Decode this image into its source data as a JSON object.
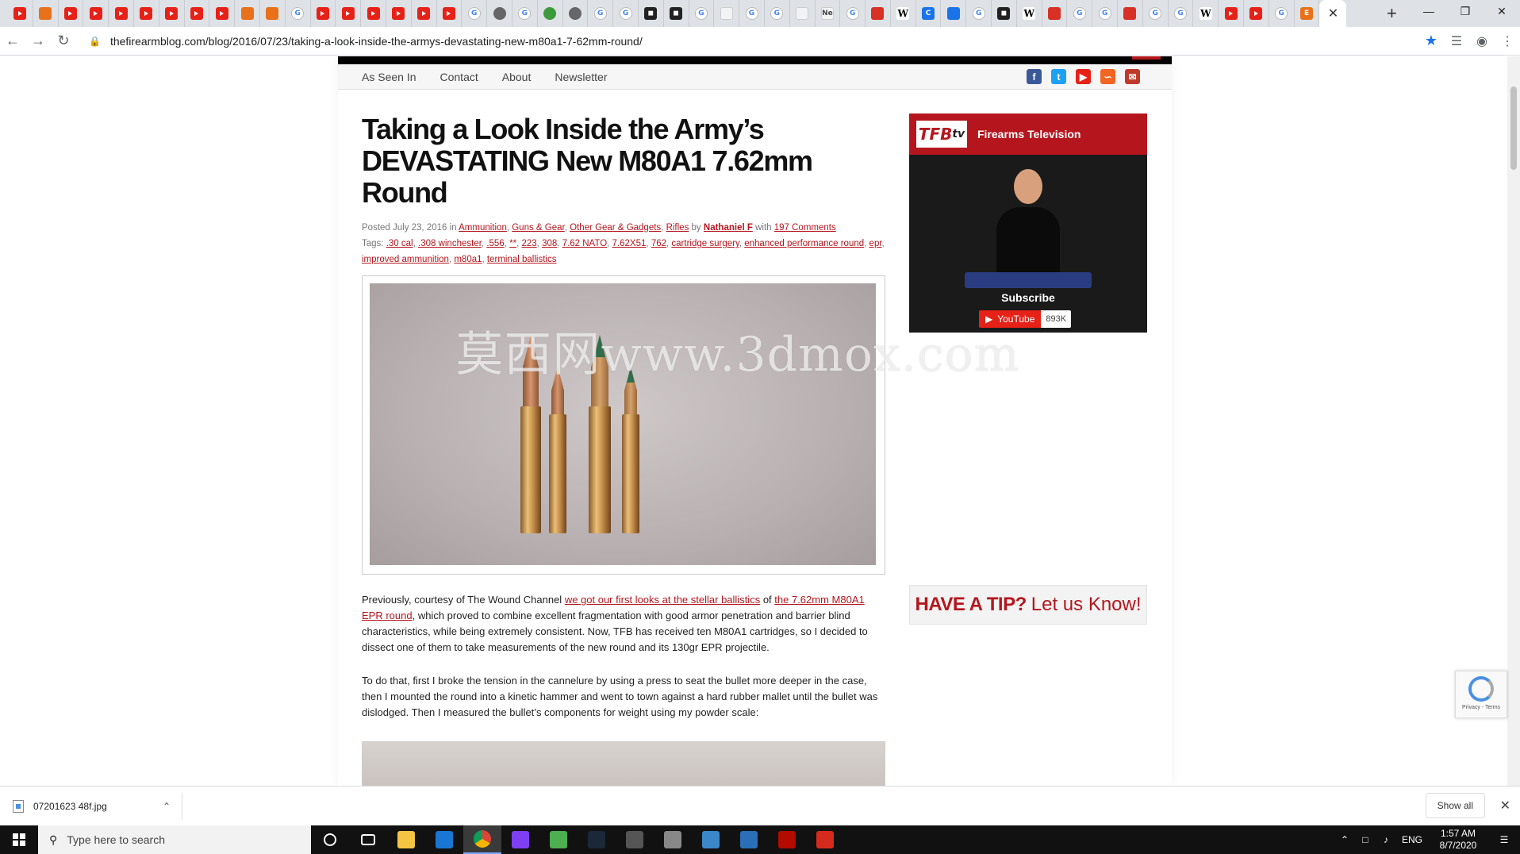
{
  "browser": {
    "tab_icons": [
      "yt",
      "hat",
      "yt",
      "yt",
      "yt",
      "yt",
      "yt",
      "yt",
      "yt",
      "shield",
      "shield",
      "g",
      "yt",
      "yt",
      "yt",
      "yt",
      "yt",
      "yt",
      "g",
      "globe",
      "g",
      "green",
      "globe",
      "g",
      "g",
      "dark",
      "dark",
      "g",
      "light",
      "g",
      "g",
      "search",
      "ne",
      "g",
      "red",
      "w",
      "cb",
      "blue",
      "g",
      "dark",
      "w",
      "red",
      "g",
      "g",
      "red",
      "g",
      "g",
      "w",
      "yt",
      "yt",
      "g",
      "orange"
    ],
    "active_tab_close": "✕",
    "new_tab": "+",
    "minimize": "—",
    "restore": "❐",
    "close": "✕",
    "url": "thefirearmblog.com/blog/2016/07/23/taking-a-look-inside-the-armys-devastating-new-m80a1-7-62mm-round/"
  },
  "site": {
    "nav": [
      "As Seen In",
      "Contact",
      "About",
      "Newsletter"
    ]
  },
  "article": {
    "title": "Taking a Look Inside the Army’s DEVASTATING New M80A1 7.62mm Round",
    "meta_posted": "Posted July 23, 2016 in",
    "categories": [
      "Ammunition",
      "Guns & Gear",
      "Other Gear & Gadgets",
      "Rifles"
    ],
    "by": "by",
    "author": "Nathaniel F",
    "with": "with",
    "comments": "197 Comments",
    "tags_label": "Tags:",
    "tags": [
      ".30 cal",
      ".308 winchester",
      ".556",
      "**",
      "223",
      "308",
      "7.62 NATO",
      "7.62X51",
      "762",
      "cartridge surgery",
      "enhanced performance round",
      "epr",
      "improved ammunition",
      "m80a1",
      "terminal ballistics"
    ],
    "watermark": "莫西网www.3dmox.com",
    "p1_a": "Previously, courtesy of The Wound Channel ",
    "p1_link1": "we got our first looks at the stellar ballistics",
    "p1_b": " of ",
    "p1_link2": "the 7.62mm M80A1 EPR round",
    "p1_c": ", which proved to combine excellent fragmentation with good armor penetration and barrier blind characteristics, while being extremely consistent. Now, TFB has received ten M80A1 cartridges, so I decided to dissect one of them to take measurements of the new round and its 130gr EPR projectile.",
    "p2": "To do that, first I broke the tension in the cannelure by using a press to seat the bullet more deeper in the case, then I mounted the round into a kinetic hammer and went to town against a hard rubber mallet until the bullet was dislodged. Then I measured the bullet’s components for weight using my powder scale:"
  },
  "sidebar": {
    "tv_logo": "TFB",
    "tv_logo_tv": "tv",
    "tv_title": "Firearms Television",
    "subscribe": "Subscribe",
    "youtube": "YouTube",
    "subs_count": "893K",
    "tip_bold": "HAVE A TIP?",
    "tip_rest": "Let us Know!"
  },
  "recaptcha": {
    "text": "Privacy - Terms"
  },
  "downloads": {
    "file": "07201623 48f.jpg",
    "show_all": "Show all"
  },
  "taskbar": {
    "search_placeholder": "Type here to search",
    "lang": "ENG",
    "time": "1:57 AM",
    "date": "8/7/2020",
    "apps": [
      {
        "name": "cortana",
        "color": "#111"
      },
      {
        "name": "task-view",
        "color": "#111"
      },
      {
        "name": "file-explorer",
        "color": "#f4c542"
      },
      {
        "name": "mail",
        "color": "#1976d2"
      },
      {
        "name": "chrome",
        "color": "#db4437"
      },
      {
        "name": "tor",
        "color": "#7e3ff2"
      },
      {
        "name": "app-green",
        "color": "#4caf50"
      },
      {
        "name": "steam",
        "color": "#1b2838"
      },
      {
        "name": "calculator",
        "color": "#555"
      },
      {
        "name": "settings-app",
        "color": "#888"
      },
      {
        "name": "notepad",
        "color": "#3a86c8"
      },
      {
        "name": "photos",
        "color": "#2a6fb8"
      },
      {
        "name": "acrobat",
        "color": "#b30b00"
      },
      {
        "name": "solidworks",
        "color": "#d52b1e"
      }
    ]
  }
}
